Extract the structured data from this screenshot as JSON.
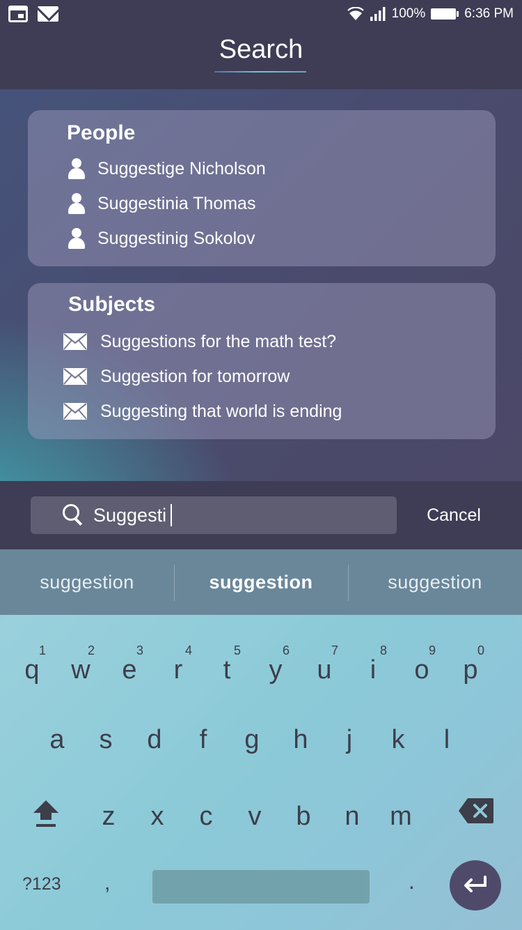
{
  "status_bar": {
    "icons_left": [
      "calendar-icon",
      "mail-icon"
    ],
    "icons_right": [
      "wifi-icon",
      "signal-icon",
      "battery-icon"
    ],
    "battery": "100%",
    "time": "6:36 PM"
  },
  "header": {
    "title": "Search"
  },
  "people": {
    "title": "People",
    "items": [
      {
        "label": "Suggestige Nicholson",
        "icon": "person-icon"
      },
      {
        "label": "Suggestinia Thomas",
        "icon": "person-icon"
      },
      {
        "label": "Suggestinig Sokolov",
        "icon": "person-icon"
      }
    ]
  },
  "subjects": {
    "title": "Subjects",
    "items": [
      {
        "label": "Suggestions for the math test?",
        "icon": "envelope-icon"
      },
      {
        "label": "Suggestion for tomorrow",
        "icon": "envelope-icon"
      },
      {
        "label": "Suggesting that world is ending",
        "icon": "envelope-icon"
      }
    ]
  },
  "search": {
    "value": "Suggesti",
    "cancel_label": "Cancel"
  },
  "keyboard": {
    "suggestions": [
      "suggestion",
      "suggestion",
      "suggestion"
    ],
    "row1": [
      {
        "key": "q",
        "num": "1"
      },
      {
        "key": "w",
        "num": "2"
      },
      {
        "key": "e",
        "num": "3"
      },
      {
        "key": "r",
        "num": "4"
      },
      {
        "key": "t",
        "num": "5"
      },
      {
        "key": "y",
        "num": "6"
      },
      {
        "key": "u",
        "num": "7"
      },
      {
        "key": "i",
        "num": "8"
      },
      {
        "key": "o",
        "num": "9"
      },
      {
        "key": "p",
        "num": "0"
      }
    ],
    "row2": [
      "a",
      "s",
      "d",
      "f",
      "g",
      "h",
      "j",
      "k",
      "l"
    ],
    "row3": [
      "z",
      "x",
      "c",
      "v",
      "b",
      "n",
      "m"
    ],
    "symbols_label": "?123",
    "comma_label": ",",
    "period_label": ".",
    "accent_color": "#4f4a6a"
  },
  "colors": {
    "header_bg": "#3e3d55",
    "card_bg": "rgba(160,158,190,0.45)",
    "search_field_bg": "#5e5d71",
    "suggestion_strip_bg": "#6a879a"
  }
}
